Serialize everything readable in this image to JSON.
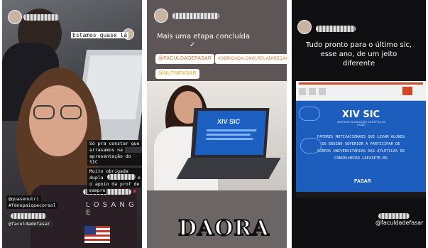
{
  "panel1": {
    "badge_text": "Estamos quase lá",
    "caption_lines": [
      "Só pra constar que",
      "arrasamos na",
      "apresentação do SIC"
    ],
    "thanks_lines": [
      "Muito obrigada minha",
      "dupla",
      "e",
      "o apoio da prof de",
      "sempre"
    ],
    "hashtags": [
      "@quasenutri",
      "#fénopaiquecorsol"
    ],
    "handle": "@faculdadefasar",
    "shirt_text": "L O S A N G E"
  },
  "panel2": {
    "title": "Mais uma etapa concluída",
    "check_icon": "checkmark-icon",
    "mention_1": "@FACULDADEFASAR",
    "mention_2": "#OBRIGADA,CNIS,PELADIREÇÃO",
    "mention_3": "@NUTRIFASAR",
    "screen_text": "XIV SIC",
    "sticker_text": "DAORA"
  },
  "panel3": {
    "title_lines": [
      "Tudo pronto para o último sic,",
      "esse ano, de um jeito",
      "diferente"
    ],
    "slide_title": "XIV SIC",
    "slide_subtitle": "SIMPÓSIO DE INICIAÇÃO CIENTÍFICA DA FASAR",
    "slide_body": [
      "FATORES MOTIVACIONAIS QUE LEVAM ALUNOS",
      "DO ENSINO SUPERIOR A PARTICIPAR DE",
      "CORPOS UNIVERSITÁRIAS DAS ATLÉTICAS DE",
      "CONSELHEIRO LAFAIETE-MG"
    ],
    "slide_footer": "FASAR",
    "handle": "@faculdadefasar"
  },
  "colors": {
    "accent_orange": "#e0702e",
    "slide_blue": "#1c5fc0",
    "story_dark": "#121212"
  }
}
